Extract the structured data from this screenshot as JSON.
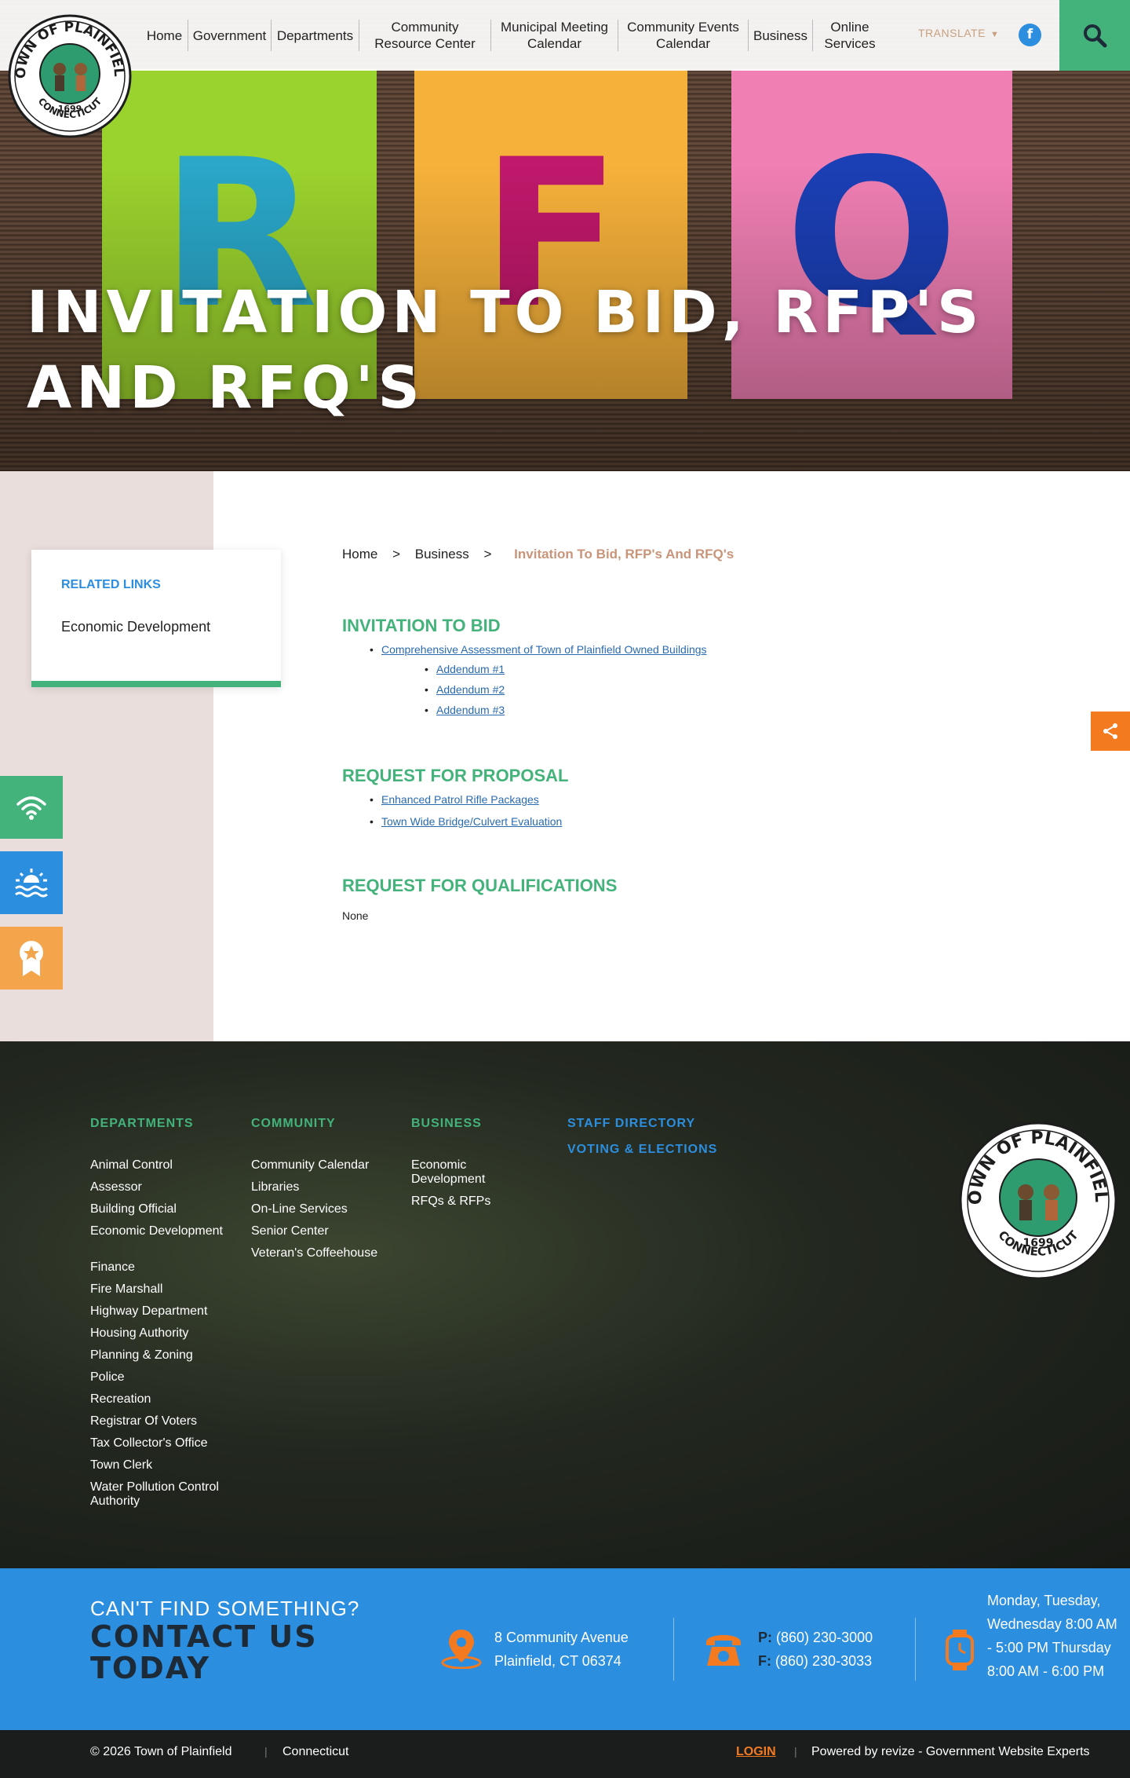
{
  "header": {
    "nav": [
      {
        "label": "Home"
      },
      {
        "label": "Government"
      },
      {
        "label": "Departments"
      },
      {
        "label": "Community Resource Center"
      },
      {
        "label": "Municipal Meeting Calendar"
      },
      {
        "label": "Community Events Calendar"
      },
      {
        "label": "Business"
      },
      {
        "label": "Online Services"
      }
    ],
    "translate": "TRANSLATE",
    "facebook": "f"
  },
  "logo": {
    "top_text": "TOWN OF PLAINFIELD",
    "year": "1699",
    "bottom_text": "CONNECTICUT"
  },
  "hero": {
    "title": "INVITATION TO BID, RFP'S AND RFQ'S",
    "notes": [
      "R",
      "F",
      "Q"
    ]
  },
  "related_links": {
    "title": "RELATED LINKS",
    "items": [
      "Economic Development"
    ]
  },
  "breadcrumb": {
    "home": "Home",
    "sep": ">",
    "business": "Business",
    "current": "Invitation To Bid, RFP's And RFQ's"
  },
  "sections": {
    "itb": {
      "title": "INVITATION TO BID",
      "item": "Comprehensive Assessment of Town of Plainfield Owned Buildings",
      "addenda": [
        "Addendum #1",
        "Addendum #2",
        "Addendum #3"
      ]
    },
    "rfp": {
      "title": "REQUEST FOR PROPOSAL",
      "items": [
        "Enhanced Patrol Rifle Packages",
        "Town Wide Bridge/Culvert Evaluation"
      ]
    },
    "rfq": {
      "title": "REQUEST FOR QUALIFICATIONS",
      "body": "None"
    }
  },
  "footer": {
    "departments": {
      "title": "DEPARTMENTS",
      "items": [
        "Animal Control",
        "Assessor",
        "Building Official",
        "Economic Development",
        "Finance",
        "Fire Marshall",
        "Highway Department",
        "Housing Authority",
        "Planning & Zoning",
        "Police",
        "Recreation",
        "Registrar Of Voters",
        "Tax Collector's Office",
        "Town Clerk",
        "Water Pollution Control Authority"
      ]
    },
    "community": {
      "title": "COMMUNITY",
      "items": [
        "Community Calendar",
        "Libraries",
        "On-Line Services",
        "Senior Center",
        "Veteran's Coffeehouse"
      ]
    },
    "business": {
      "title": "BUSINESS",
      "items": [
        "Economic Development",
        "RFQs & RFPs"
      ]
    },
    "staff_directory": "STAFF DIRECTORY",
    "voting": "VOTING & ELECTIONS"
  },
  "contact": {
    "cant_find": "CAN'T FIND SOMETHING?",
    "contact_today": "CONTACT US TODAY",
    "address_line1": "8 Community Avenue",
    "address_line2": "Plainfield, CT 06374",
    "phone_label": "P:",
    "phone": "(860) 230-3000",
    "fax_label": "F:",
    "fax": "(860) 230-3033",
    "hours": "Monday, Tuesday, Wednesday 8:00 AM - 5:00 PM Thursday 8:00 AM - 6:00 PM"
  },
  "bottom": {
    "copyright": "© 2026 Town of Plainfield",
    "state": "Connecticut",
    "login": "LOGIN",
    "powered": "Powered by revize - Government Website Experts",
    "sep": "|"
  },
  "colors": {
    "green": "#43b27b",
    "blue": "#2c8ede",
    "orange": "#f47a20",
    "tan": "#c8957a"
  }
}
